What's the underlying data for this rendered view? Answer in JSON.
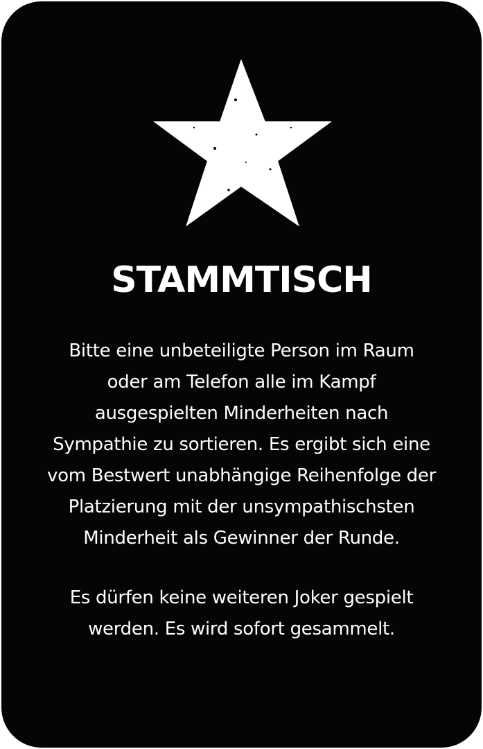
{
  "card": {
    "background_color": "#050505",
    "text_color": "#ffffff",
    "emblem_icon": "star-icon",
    "title": "STAMMTISCH",
    "paragraph1_lines": [
      "Bitte eine unbeteiligte Person im Raum",
      "oder am Telefon alle im Kampf",
      "ausgespielten Minderheiten nach",
      "Sympathie zu sortieren. Es ergibt sich eine",
      "vom Bestwert unabhängige Reihenfolge der",
      "Platzierung mit der unsympathischsten",
      "Minderheit als Gewinner der Runde."
    ],
    "paragraph2_lines": [
      "Es dürfen keine weiteren Joker gespielt",
      "werden. Es wird sofort gesammelt."
    ]
  }
}
